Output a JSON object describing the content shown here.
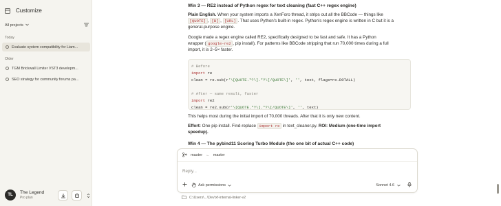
{
  "sidebar": {
    "title": "Customize",
    "filter_label": "All projects",
    "sections": [
      {
        "label": "Today",
        "items": [
          {
            "label": "Evaluate system compatibility for Liam...",
            "active": true
          }
        ]
      },
      {
        "label": "Older",
        "items": [
          {
            "label": "TGM Brickwall Limiter VST3 developm..."
          },
          {
            "label": "SEO strategy for community forums pa..."
          }
        ]
      }
    ],
    "user": {
      "initials": "TL",
      "name": "The Legend",
      "plan": "Pro plan"
    }
  },
  "content": {
    "win3_title": "Win 3 — RE2 instead of Python regex for text cleaning (fast C++ regex engine)",
    "plain_lbl": "Plain English.",
    "plain_1": " When your system imports a XenForo thread, it strips out all the BBCode — things like",
    "code_quote": "[QUOTE]",
    "sep1": ", ",
    "code_b": "[B]",
    "sep2": ", ",
    "code_url": "[URL]",
    "plain_2": ". That uses Python's built-in regex. Python's regex engine is written in C but it is a",
    "plain_3": "general-purpose engine.",
    "google_1": "Google made a regex engine called RE2, specifically designed to be fast and safe. It has a Python",
    "google_2a": "wrapper (",
    "code_gre2": "google-re2",
    "google_2b": ", pip install). For patterns like BBCode stripping that run 70,000 times during a full",
    "google_3": "import, it is 2–5× faster.",
    "code_lines": [
      {
        "parts": [
          {
            "cls": "cm",
            "t": "# Before"
          }
        ]
      },
      {
        "parts": [
          {
            "cls": "kw",
            "t": "import"
          },
          {
            "cls": "",
            "t": " re"
          }
        ]
      },
      {
        "parts": [
          {
            "cls": "",
            "t": "clean = re.sub(r"
          },
          {
            "cls": "st",
            "t": "'\\[QUOTE.*?\\].*?\\[/QUOTE\\]'"
          },
          {
            "cls": "",
            "t": ", "
          },
          {
            "cls": "st",
            "t": "''"
          },
          {
            "cls": "",
            "t": ", text, flags=re.DOTALL)"
          }
        ]
      },
      {
        "parts": [
          {
            "cls": "",
            "t": ""
          }
        ]
      },
      {
        "parts": [
          {
            "cls": "cm",
            "t": "# After — same result, faster"
          }
        ]
      },
      {
        "parts": [
          {
            "cls": "kw",
            "t": "import"
          },
          {
            "cls": "",
            "t": " re2"
          }
        ]
      },
      {
        "parts": [
          {
            "cls": "",
            "t": "clean = re2.sub(r"
          },
          {
            "cls": "st",
            "t": "'\\[QUOTE.*?\\].*?\\[/QUOTE\\]'"
          },
          {
            "cls": "",
            "t": ", "
          },
          {
            "cls": "st",
            "t": "''"
          },
          {
            "cls": "",
            "t": ", text)"
          }
        ]
      }
    ],
    "helps": "This helps most during the initial import of 70,000 threads. After that it is only new content.",
    "effort_lbl": "Effort:",
    "effort_1": " One pip install. Find-replace ",
    "code_import_re": "import re",
    "effort_2": " in text_cleaner.py. ",
    "roi_lbl": "ROI: Medium (one-time import",
    "roi_2": "speedup).",
    "win4_title": "Win 4 — The pybind11 Scoring Turbo Module (the one bit of actual C++ code)"
  },
  "composer": {
    "branch_from": "master",
    "branch_arrow": "←",
    "branch_to": "master",
    "placeholder": "Reply...",
    "permissions_label": "Ask permissions",
    "model_label": "Sonnet 4.6"
  },
  "footer_path": "C:\\Users\\...\\Dev\\xf-internal-linker-v2"
}
